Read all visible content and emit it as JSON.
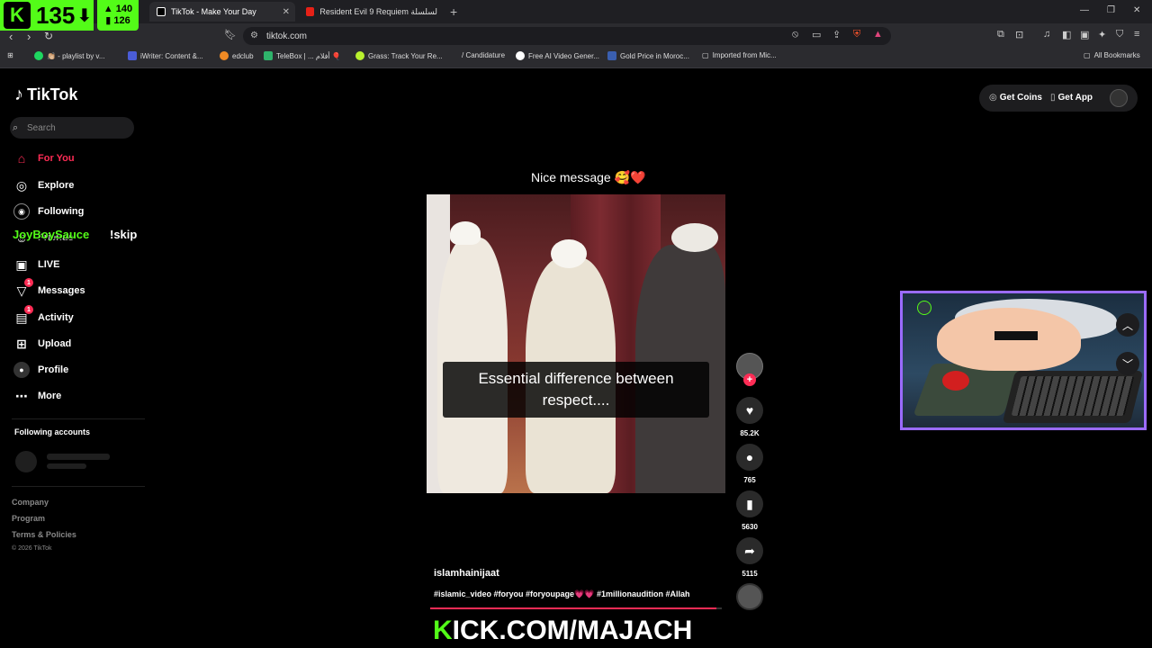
{
  "stream": {
    "badge_number": "135",
    "badge_arrow": "⬇",
    "viewers_top": "140",
    "viewers_bottom": "126",
    "kick_url_k": "K",
    "kick_url_rest": "ICK.COM/MAJACH"
  },
  "browser": {
    "tabs": [
      {
        "label": "TikTok - Make Your Day",
        "active": true,
        "color": "#000000"
      },
      {
        "label": "Resident Evil 9 Requiem قلب السلسلة",
        "active": false,
        "color": "#e62117"
      }
    ],
    "url": "tiktok.com",
    "bookmarks": [
      {
        "label": "👏🏼 - playlist by v...",
        "color": "#1ed760"
      },
      {
        "label": "iWriter: Content &...",
        "color": "#4a5cd6"
      },
      {
        "label": "edclub",
        "color": "#f08a24"
      },
      {
        "label": "TeleBox | ... أفلام 🎈",
        "color": "#2fb36b"
      },
      {
        "label": "Grass: Track Your Re...",
        "color": "#b8f02e"
      },
      {
        "label": "/ Candidature",
        "color": "#2b2b2f"
      },
      {
        "label": "Free AI Video Gener...",
        "color": "#ffffff"
      },
      {
        "label": "Gold Price in Moroc...",
        "color": "#3a5fb0"
      },
      {
        "label": "Imported from Mic...",
        "color": "#2b2b2f"
      },
      {
        "label": "All Bookmarks",
        "color": "#2b2b2f"
      }
    ]
  },
  "tiktok": {
    "logo": "TikTok",
    "search_placeholder": "Search",
    "nav": [
      {
        "label": "For You",
        "icon": "home-icon",
        "active": true
      },
      {
        "label": "Explore",
        "icon": "compass-icon"
      },
      {
        "label": "Following",
        "icon": "following-icon"
      },
      {
        "label": "Friends",
        "icon": "friends-icon"
      },
      {
        "label": "LIVE",
        "icon": "live-icon"
      },
      {
        "label": "Messages",
        "icon": "messages-icon",
        "badge": "1"
      },
      {
        "label": "Activity",
        "icon": "activity-icon",
        "badge": "1"
      },
      {
        "label": "Upload",
        "icon": "upload-icon"
      },
      {
        "label": "Profile",
        "icon": "profile-icon"
      },
      {
        "label": "More",
        "icon": "more-icon"
      }
    ],
    "overlay_user": "JoyBoySauce",
    "overlay_cmd": "!skip",
    "following_accounts": "Following accounts",
    "footer": [
      "Company",
      "Program",
      "Terms & Policies"
    ],
    "copyright": "© 2026 TikTok",
    "get_coins": "Get Coins",
    "get_app": "Get App",
    "colors": {
      "accent": "#fe2c55",
      "kick": "#53fc18"
    }
  },
  "video": {
    "title": "Nice message 🥰❤️",
    "caption": "Essential difference between respect....",
    "author": "islamhainijaat",
    "description": "#islamic_video #foryou #foryoupage💗💗 #1millionaudition #Allah",
    "likes": "85.2K",
    "comments": "765",
    "saves": "5630",
    "shares": "5115",
    "progress": 0.98
  }
}
